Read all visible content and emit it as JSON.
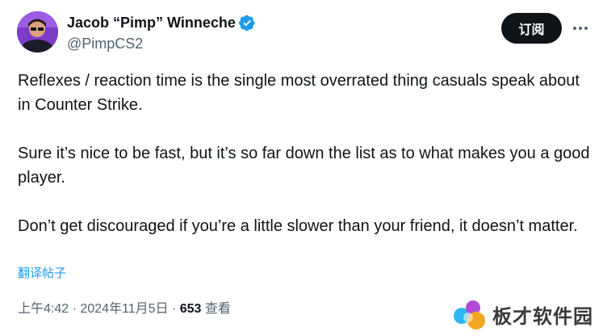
{
  "author": {
    "display_name": "Jacob “Pimp” Winneche",
    "handle": "@PimpCS2",
    "verified": true
  },
  "header": {
    "subscribe_label": "订阅",
    "more_icon": "more-horizontal-icon"
  },
  "tweet": {
    "paragraphs": [
      "Reflexes / reaction time is the single most overrated thing casuals speak about in Counter Strike.",
      "Sure it’s nice to be fast, but it’s so far down the list as to what makes you a good player.",
      "Don’t get discouraged if you’re a little slower than your friend, it doesn’t matter."
    ],
    "translate_label": "翻译帖子"
  },
  "meta": {
    "time": "上午4:42",
    "separator": "·",
    "date": "2024年11月5日",
    "views_count": "653",
    "views_label": "查看"
  },
  "watermark": {
    "text": "板才软件园"
  },
  "colors": {
    "accent": "#1d9bf0",
    "text_primary": "#0f1419",
    "text_secondary": "#536471",
    "button_bg": "#0f1419"
  }
}
